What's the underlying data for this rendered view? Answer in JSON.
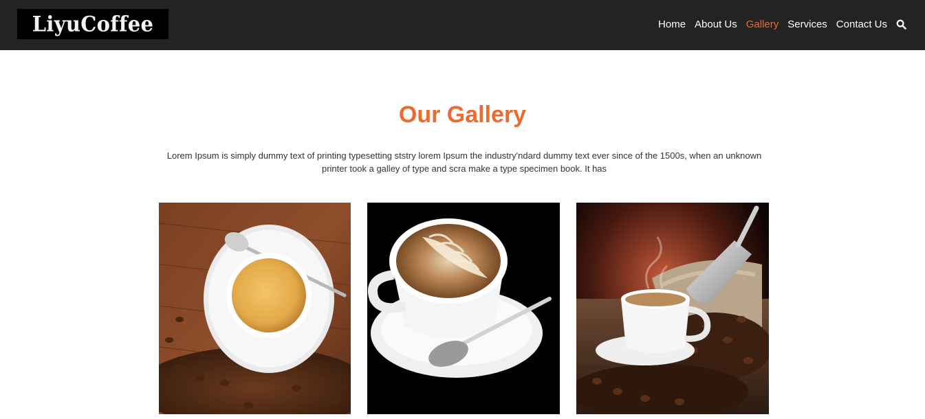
{
  "header": {
    "logo_text": "LiyuCoffee",
    "nav": [
      {
        "label": "Home"
      },
      {
        "label": "About Us"
      },
      {
        "label": "Gallery",
        "active": true
      },
      {
        "label": "Services"
      },
      {
        "label": "Contact Us"
      }
    ],
    "search_icon": "search-icon"
  },
  "gallery": {
    "title": "Our Gallery",
    "description": "Lorem Ipsum is simply dummy text of printing typesetting ststry lorem Ipsum the industry'ndard dummy text ever since of the 1500s, when an unknown printer took a galley of type and scra make a type specimen book. It has"
  },
  "colors": {
    "accent": "#ef6a2f",
    "header_bg": "#232323"
  }
}
